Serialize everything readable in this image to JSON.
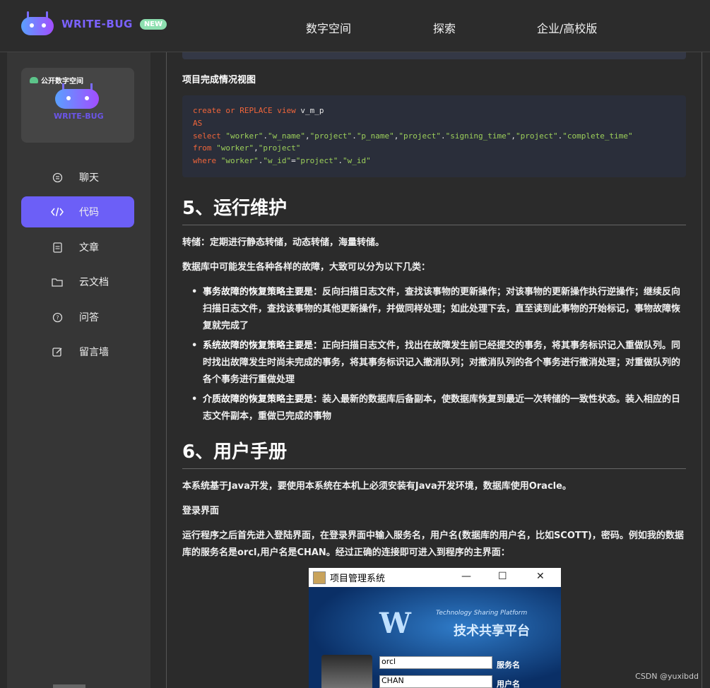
{
  "header": {
    "brand": "WRITE-BUG",
    "new_badge": "NEW",
    "nav": [
      "数字空间",
      "探索",
      "企业/高校版"
    ]
  },
  "sidebar": {
    "card_tag": "公开数字空间",
    "card_brand": "WRITE-BUG",
    "items": [
      {
        "label": "聊天",
        "icon": "chat-icon",
        "active": false
      },
      {
        "label": "代码",
        "icon": "code-icon",
        "active": true
      },
      {
        "label": "文章",
        "icon": "article-icon",
        "active": false
      },
      {
        "label": "云文档",
        "icon": "folder-icon",
        "active": false
      },
      {
        "label": "问答",
        "icon": "question-icon",
        "active": false
      },
      {
        "label": "留言墙",
        "icon": "edit-icon",
        "active": false
      }
    ]
  },
  "content": {
    "view_heading": "项目完成情况视图",
    "code": [
      [
        {
          "t": "create or REPLACE view ",
          "c": "kw"
        },
        {
          "t": "v_m_p",
          "c": "pl"
        }
      ],
      [
        {
          "t": "AS",
          "c": "kw"
        }
      ],
      [
        {
          "t": "select ",
          "c": "kw"
        },
        {
          "t": "\"worker\"",
          "c": "str"
        },
        {
          "t": ".",
          "c": "pl"
        },
        {
          "t": "\"w_name\"",
          "c": "str"
        },
        {
          "t": ",",
          "c": "pl"
        },
        {
          "t": "\"project\"",
          "c": "str"
        },
        {
          "t": ".",
          "c": "pl"
        },
        {
          "t": "\"p_name\"",
          "c": "str"
        },
        {
          "t": ",",
          "c": "pl"
        },
        {
          "t": "\"project\"",
          "c": "str"
        },
        {
          "t": ".",
          "c": "pl"
        },
        {
          "t": "\"signing_time\"",
          "c": "str"
        },
        {
          "t": ",",
          "c": "pl"
        },
        {
          "t": "\"project\"",
          "c": "str"
        },
        {
          "t": ".",
          "c": "pl"
        },
        {
          "t": "\"complete_time\"",
          "c": "str"
        }
      ],
      [
        {
          "t": "from ",
          "c": "kw"
        },
        {
          "t": "\"worker\"",
          "c": "str"
        },
        {
          "t": ",",
          "c": "pl"
        },
        {
          "t": "\"project\"",
          "c": "str"
        }
      ],
      [
        {
          "t": "where ",
          "c": "kw"
        },
        {
          "t": "\"worker\"",
          "c": "str"
        },
        {
          "t": ".",
          "c": "pl"
        },
        {
          "t": "\"w_id\"",
          "c": "str"
        },
        {
          "t": "=",
          "c": "pl"
        },
        {
          "t": "\"project\"",
          "c": "str"
        },
        {
          "t": ".",
          "c": "pl"
        },
        {
          "t": "\"w_id\"",
          "c": "str"
        }
      ]
    ],
    "section5_title": "5、运行维护",
    "dump_text": "转储：定期进行静态转储，动态转储，海量转储。",
    "faults_intro": "数据库中可能发生各种各样的故障，大致可以分为以下几类：",
    "bullets": [
      {
        "bold": "事务故障的恢复策略主要是：",
        "text": "反向扫描日志文件，查找该事物的更新操作；对该事物的更新操作执行逆操作；继续反向扫描日志文件，查找该事物的其他更新操作，并做同样处理；如此处理下去，直至读到此事物的开始标记，事物故障恢复就完成了"
      },
      {
        "bold": "系统故障的恢复策略主要是：",
        "text": "正向扫描日志文件，找出在故障发生前已经提交的事务，将其事务标识记入重做队列。同时找出故障发生时尚未完成的事务，将其事务标识记入撤消队列；对撤消队列的各个事务进行撤消处理；对重做队列的各个事务进行重做处理"
      },
      {
        "bold": "介质故障的恢复策略主要是：",
        "text": "装入最新的数据库后备副本，使数据库恢复到最近一次转储的一致性状态。装入相应的日志文件副本，重做已完成的事物"
      }
    ],
    "section6_title": "6、用户手册",
    "java_text": "本系统基于Java开发，要使用本系统在本机上必须安装有Java开发环境，数据库使用Oracle。",
    "login_heading": "登录界面",
    "login_text": "运行程序之后首先进入登陆界面，在登录界面中输入服务名，用户名(数据库的用户名，比如SCOTT)，密码。例如我的数据库的服务名是orcl,用户名是CHAN。经过正确的连接即可进入到程序的主界面："
  },
  "screenshot": {
    "window_title": "项目管理系统",
    "minimize": "—",
    "maximize": "☐",
    "close": "✕",
    "logo_letter": "W",
    "logo_tagline": "Technology Sharing Platform",
    "logo_cn": "技术共享平台",
    "service_value": "orcl",
    "service_label": "服务名",
    "user_value": "CHAN",
    "user_label": "用户名"
  },
  "watermark": "CSDN @yuxibdd"
}
